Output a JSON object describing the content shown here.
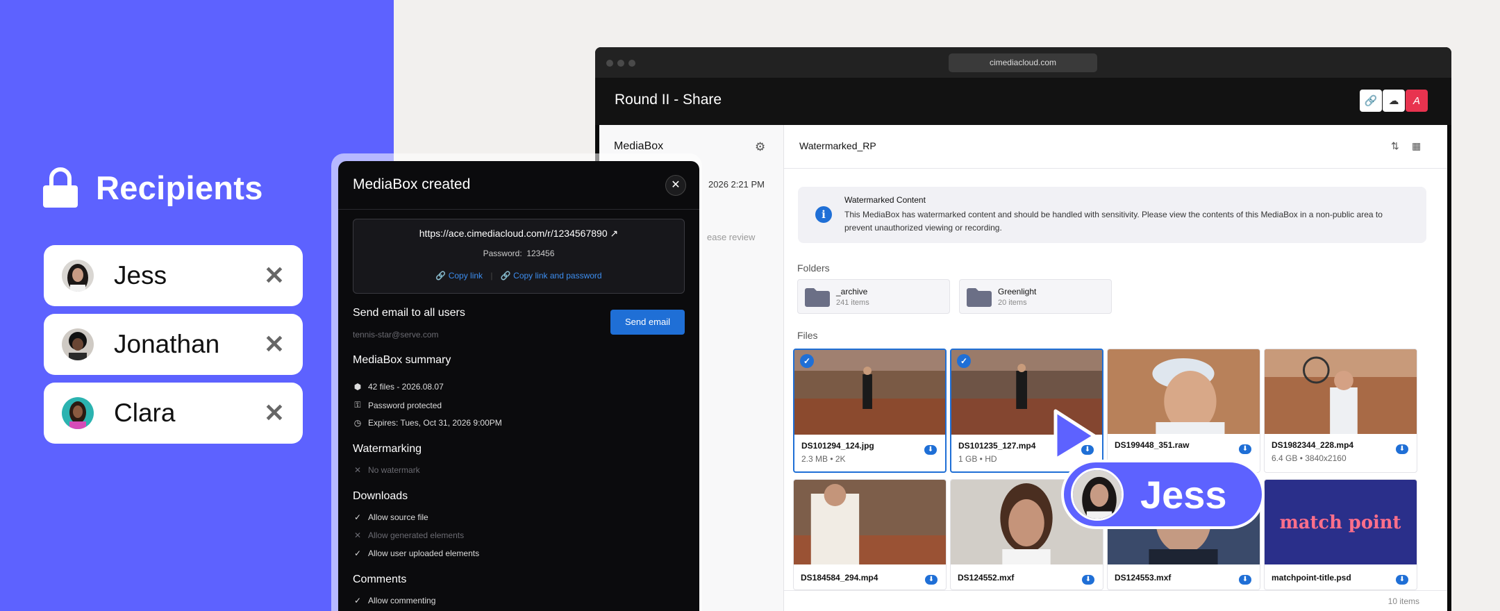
{
  "recipients": {
    "title": "Recipients",
    "people": [
      {
        "name": "Jess"
      },
      {
        "name": "Jonathan"
      },
      {
        "name": "Clara"
      }
    ]
  },
  "browser": {
    "url": "cimediacloud.com",
    "app_title": "Round II - Share"
  },
  "sidebar": {
    "title": "MediaBox",
    "date_fragment": "2026 2:21 PM",
    "review_fragment": "ease review"
  },
  "main": {
    "title": "Watermarked_RP",
    "banner": {
      "title": "Watermarked Content",
      "text": "This MediaBox has watermarked content and should be handled with sensitivity. Please view the contents of this MediaBox in a non-public area to prevent unauthorized viewing or recording."
    },
    "folders_label": "Folders",
    "folders": [
      {
        "name": "_archive",
        "count": "241 items"
      },
      {
        "name": "Greenlight",
        "count": "20 items"
      }
    ],
    "files_label": "Files",
    "files": [
      {
        "name": "DS101294_124.jpg",
        "meta": "2.3 MB • 2K",
        "selected": true
      },
      {
        "name": "DS101235_127.mp4",
        "meta": "1 GB • HD",
        "selected": true
      },
      {
        "name": "DS199448_351.raw",
        "meta": "",
        "selected": false
      },
      {
        "name": "DS1982344_228.mp4",
        "meta": "6.4 GB • 3840x2160",
        "selected": false
      },
      {
        "name": "DS184584_294.mp4",
        "meta": "",
        "selected": false
      },
      {
        "name": "DS124552.mxf",
        "meta": "",
        "selected": false
      },
      {
        "name": "DS124553.mxf",
        "meta": "",
        "selected": false
      },
      {
        "name": "matchpoint-title.psd",
        "meta": "",
        "selected": false
      }
    ],
    "thumb_text": "match point",
    "items_count": "10 items"
  },
  "modal": {
    "title": "MediaBox created",
    "link": "https://ace.cimediacloud.com/r/1234567890",
    "password_label": "Password:",
    "password": "123456",
    "copy_link": "Copy link",
    "copy_link_password": "Copy link and password",
    "send_title": "Send email to all users",
    "send_email_addr": "tennis-star@serve.com",
    "send_button": "Send email",
    "summary_title": "MediaBox summary",
    "summary": [
      "42 files - 2026.08.07",
      "Password protected",
      "Expires: Tues, Oct 31, 2026 9:00PM"
    ],
    "watermark_title": "Watermarking",
    "watermark_value": "No watermark",
    "downloads_title": "Downloads",
    "downloads": [
      {
        "label": "Allow source file",
        "enabled": true
      },
      {
        "label": "Allow generated elements",
        "enabled": false
      },
      {
        "label": "Allow user uploaded elements",
        "enabled": true
      }
    ],
    "comments_title": "Comments",
    "comments": [
      "Allow commenting"
    ]
  },
  "cursor_label": "Jess",
  "colors": {
    "accent": "#5d62ff",
    "primary": "#1f6fd6",
    "dark": "#0b0b0d"
  }
}
